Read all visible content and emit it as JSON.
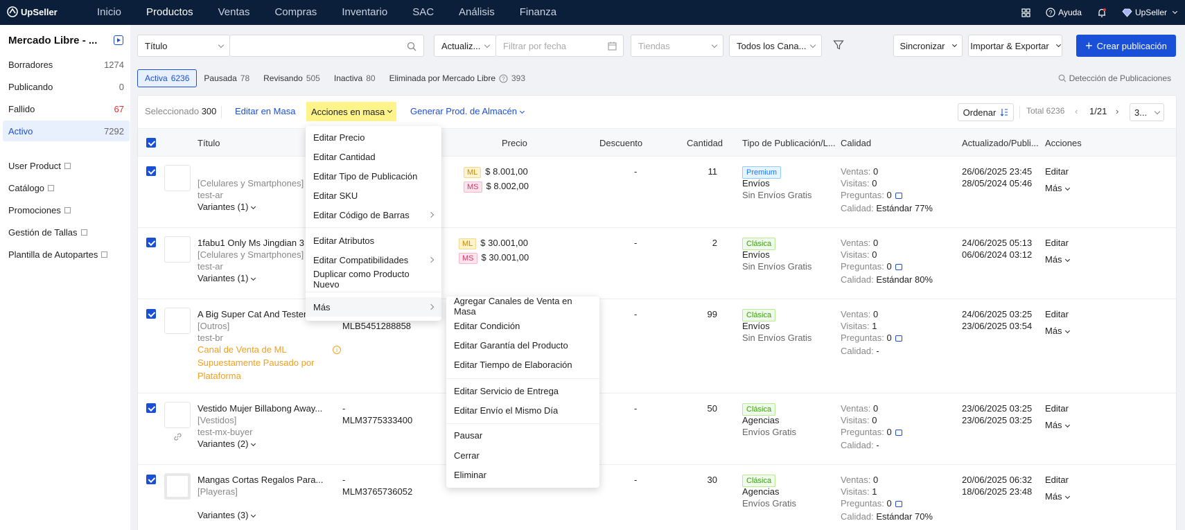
{
  "topbar": {
    "logo": "UpSeller",
    "nav": [
      "Inicio",
      "Productos",
      "Ventas",
      "Compras",
      "Inventario",
      "SAC",
      "Análisis",
      "Finanza"
    ],
    "help": "Ayuda",
    "account": "UpSeller"
  },
  "sidebar": {
    "title": "Mercado Libre - ...",
    "items": [
      {
        "label": "Borradores",
        "count": "1274"
      },
      {
        "label": "Publicando",
        "count": "0"
      },
      {
        "label": "Fallido",
        "count": "67"
      },
      {
        "label": "Activo",
        "count": "7292"
      }
    ],
    "links": [
      "User Product",
      "Catálogo",
      "Promociones",
      "Gestión de Tallas",
      "Plantilla de Autopartes"
    ]
  },
  "filters": {
    "field": "Título",
    "search_placeholder": "",
    "update": "Actualiz...",
    "date_placeholder": "Filtrar por fecha",
    "stores": "Tiendas",
    "channels": "Todos los Cana...",
    "sync": "Sincronizar",
    "import_export": "Importar & Exportar",
    "create": "Crear publicación"
  },
  "tabs": [
    {
      "label": "Activa",
      "count": "6236"
    },
    {
      "label": "Pausada",
      "count": "78"
    },
    {
      "label": "Revisando",
      "count": "505"
    },
    {
      "label": "Inactiva",
      "count": "80"
    },
    {
      "label": "Eliminada por Mercado Libre",
      "count": "393"
    }
  ],
  "detection": "Detección de Publicaciones",
  "actionbar": {
    "selected_label": "Seleccionado",
    "selected_count": "300",
    "edit_mass": "Editar en Masa",
    "mass_actions": "Acciones en masa",
    "generate": "Generar Prod. de Almacén",
    "order": "Ordenar",
    "total": "Total 6236",
    "page": "1/21",
    "page_size": "3..."
  },
  "columns": [
    "Título",
    "Precio",
    "Descuento",
    "Cantidad",
    "Tipo de Publicación/L...",
    "Calidad",
    "Actualizado/Publi...",
    "Acciones"
  ],
  "rows": [
    {
      "title": "",
      "category": "[Celulares y Smartphones]",
      "store": "test-ar",
      "variants": "Variantes (1)",
      "tag1": "ML",
      "price1": "$ 8.001,00",
      "tag2": "MS",
      "price2": "$ 8.002,00",
      "discount": "-",
      "qty": "11",
      "type": "Premium",
      "ship": "Envíos",
      "free": "Sin Envíos Gratis",
      "sales": "0",
      "visits": "0",
      "questions": "0",
      "quality": "Estándar 77%",
      "updated": "26/06/2025 23:45",
      "published": "28/05/2024 05:46"
    },
    {
      "title": "1fabu1 Only Ms Jingdian 3",
      "category": "[Celulares y Smartphones]",
      "store": "test-ar",
      "variants": "Variantes (1)",
      "tag1": "ML",
      "price1": "$ 30.001,00",
      "tag2": "MS",
      "price2": "$ 30.001,00",
      "discount": "-",
      "qty": "2",
      "type": "Clásica",
      "ship": "Envíos",
      "free": "Sin Envíos Gratis",
      "sales": "0",
      "visits": "0",
      "questions": "0",
      "quality": "Estándar 80%",
      "updated": "24/06/2025 05:13",
      "published": "06/06/2024 03:12"
    },
    {
      "title": "A Big Super Cat And Tester",
      "category": "[Outros]",
      "store": "test-br",
      "warn": "Canal de Venta de ML Supuestamente Pausado por Plataforma",
      "warn_l1": "Canal de Venta de ML",
      "warn_l2": "Supuestamente Pausado por",
      "warn_l3": "Plataforma",
      "id_prefix": "- y",
      "mlb": "MLB5451288858",
      "discount": "-",
      "qty": "99",
      "type": "Clásica",
      "ship": "Envíos",
      "free": "Sin Envíos Gratis",
      "sales": "0",
      "visits": "1",
      "questions": "0",
      "quality": "-",
      "updated": "24/06/2025 03:25",
      "published": "23/06/2025 03:54"
    },
    {
      "title": "Vestido Mujer Billabong Away...",
      "category": "[Vestidos]",
      "store": "test-mx-buyer",
      "variants": "Variantes (2)",
      "id_prefix": "-",
      "mlb": "MLM3775333400",
      "discount": "-",
      "qty": "50",
      "type": "Clásica",
      "ship": "Agencias",
      "free": "Envíos Gratis",
      "sales": "0",
      "visits": "0",
      "questions": "0",
      "quality": "-",
      "updated": "23/06/2025 03:25",
      "published": "23/06/2025 03:25"
    },
    {
      "title": "Mangas Cortas Regalos Para...",
      "category": "[Playeras]",
      "variants": "Variantes (3)",
      "id_prefix": "-",
      "mlb": "MLM3765736052",
      "discount": "-",
      "qty": "30",
      "type": "Clásica",
      "ship": "Agencias",
      "free": "Envíos Gratis",
      "sales": "0",
      "visits": "1",
      "questions": "0",
      "quality": "Estándar 70%",
      "updated": "20/06/2025 06:32",
      "published": "18/06/2025 23:48"
    }
  ],
  "labels": {
    "sales": "Ventas:",
    "visits": "Visitas:",
    "questions": "Preguntas:",
    "quality": "Calidad:",
    "edit": "Editar",
    "more": "Más"
  },
  "menu": {
    "items": [
      "Editar Precio",
      "Editar Cantidad",
      "Editar Tipo de Publicación",
      "Editar SKU",
      "Editar Código de Barras",
      "Editar Atributos",
      "Editar Compatibilidades",
      "Duplicar como Producto Nuevo",
      "Más"
    ]
  },
  "submenu": {
    "items": [
      "Agregar Canales de Venta en Masa",
      "Editar Condición",
      "Editar Garantía del Producto",
      "Editar Tiempo de Elaboración",
      "Editar Servicio de Entrega",
      "Editar Envío el Mismo Día",
      "Pausar",
      "Cerrar",
      "Eliminar"
    ]
  },
  "colors": {
    "primary": "#1a4fd8",
    "topbar": "#0b1f3a",
    "highlight": "#fef48a",
    "danger": "#e03030",
    "warning": "#f0a020"
  }
}
